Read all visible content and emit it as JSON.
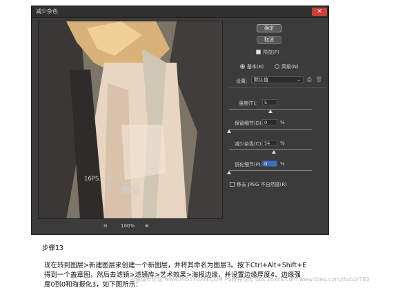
{
  "dialog": {
    "title": "减少杂色",
    "close_label": "✕",
    "ok_label": "确定",
    "cancel_label": "取消",
    "preview_label": "预览(P)",
    "preview_checked": true,
    "mode_basic": "基本(B)",
    "mode_advanced": "高级(N)",
    "mode_selected": "basic",
    "settings_label": "设置:",
    "settings_value": "默认值",
    "settings_icons": [
      "save-icon",
      "trash-icon"
    ],
    "sliders": [
      {
        "label": "强度(T):",
        "value": "5",
        "unit": "",
        "fraction": 0.5
      },
      {
        "label": "保留细节(D):",
        "value": "0",
        "unit": "%",
        "fraction": 0.0
      },
      {
        "label": "减少杂色(C):",
        "value": "54",
        "unit": "%",
        "fraction": 0.54
      },
      {
        "label": "锐化细节(P):",
        "value": "0",
        "unit": "%",
        "fraction": 0.0
      }
    ],
    "jpeg_label": "移去 JPEG 不自然感(R)",
    "jpeg_checked": false,
    "zoom": "100%",
    "zoom_out": "⊖",
    "zoom_in": "⊕"
  },
  "preview_watermark": "16PS.com",
  "preview_watermark2": "联盟",
  "article": {
    "step": "步骤13",
    "line1": "现在转到图层>新建图层来创建一个新图层，并将其命名为图层3。按下Ctrl+Alt+Shift+E",
    "line2": "得到一个盖章图，然后去滤镜>滤镜库>艺术效果>海报边缘，并设置边缘厚度4、边缘强",
    "line3": "度0到0和海报化3，如下图所示：",
    "watermark": "思缘设计论坛 www.MISSYUAN.COM  PS教程论坛 bbs.16xx8.com  www.tbeg.com/(tuts)/783"
  }
}
